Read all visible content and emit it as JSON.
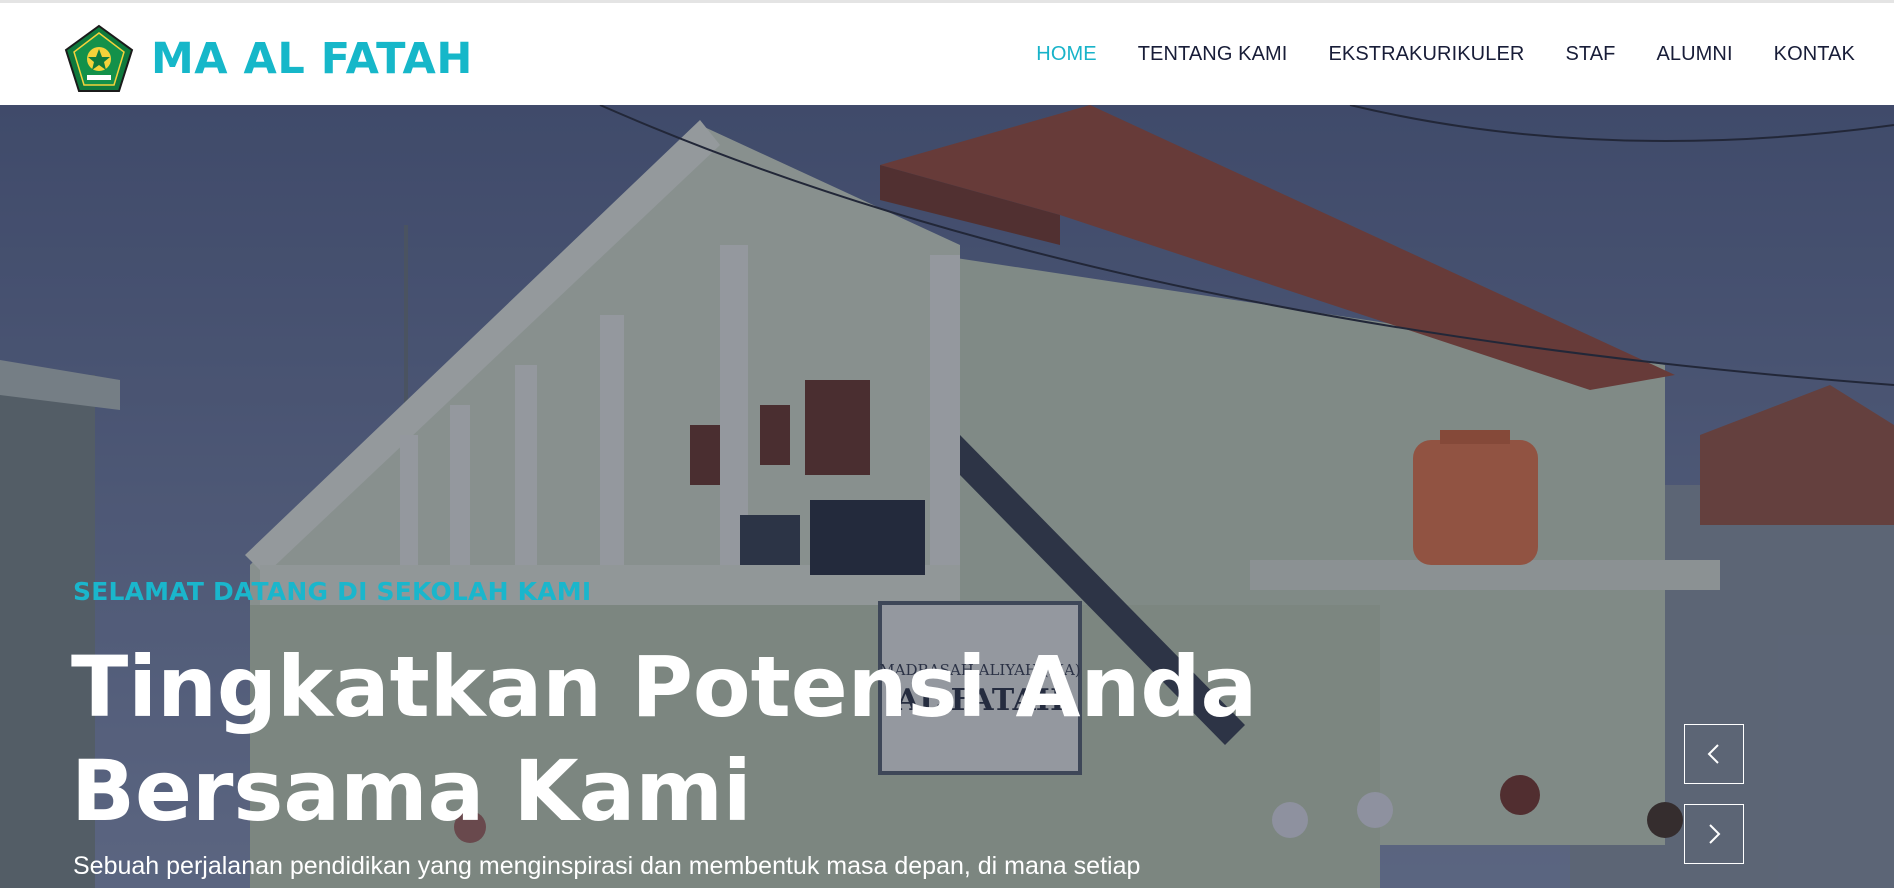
{
  "brand": {
    "name": "MA AL FATAH",
    "logo_icon": "school-crest-icon"
  },
  "nav": {
    "items": [
      {
        "label": "HOME",
        "active": true
      },
      {
        "label": "TENTANG KAMI",
        "active": false
      },
      {
        "label": "EKSTRAKURIKULER",
        "active": false
      },
      {
        "label": "STAF",
        "active": false
      },
      {
        "label": "ALUMNI",
        "active": false
      },
      {
        "label": "KONTAK",
        "active": false
      }
    ]
  },
  "hero": {
    "kicker": "SELAMAT DATANG DI SEKOLAH KAMI",
    "headline_line1": "Tingkatkan Potensi Anda",
    "headline_line2": "Bersama Kami",
    "subline": "Sebuah perjalanan pendidikan yang menginspirasi dan membentuk masa depan, di mana setiap",
    "photo": {
      "sign_line1": "MADRASAH ALIYAH (MA)",
      "sign_line2": "AL FATAH"
    },
    "prev_icon": "chevron-left-icon",
    "next_icon": "chevron-right-icon"
  },
  "colors": {
    "accent": "#16b7c9",
    "nav_text": "#181d38",
    "overlay": "#181d38"
  }
}
